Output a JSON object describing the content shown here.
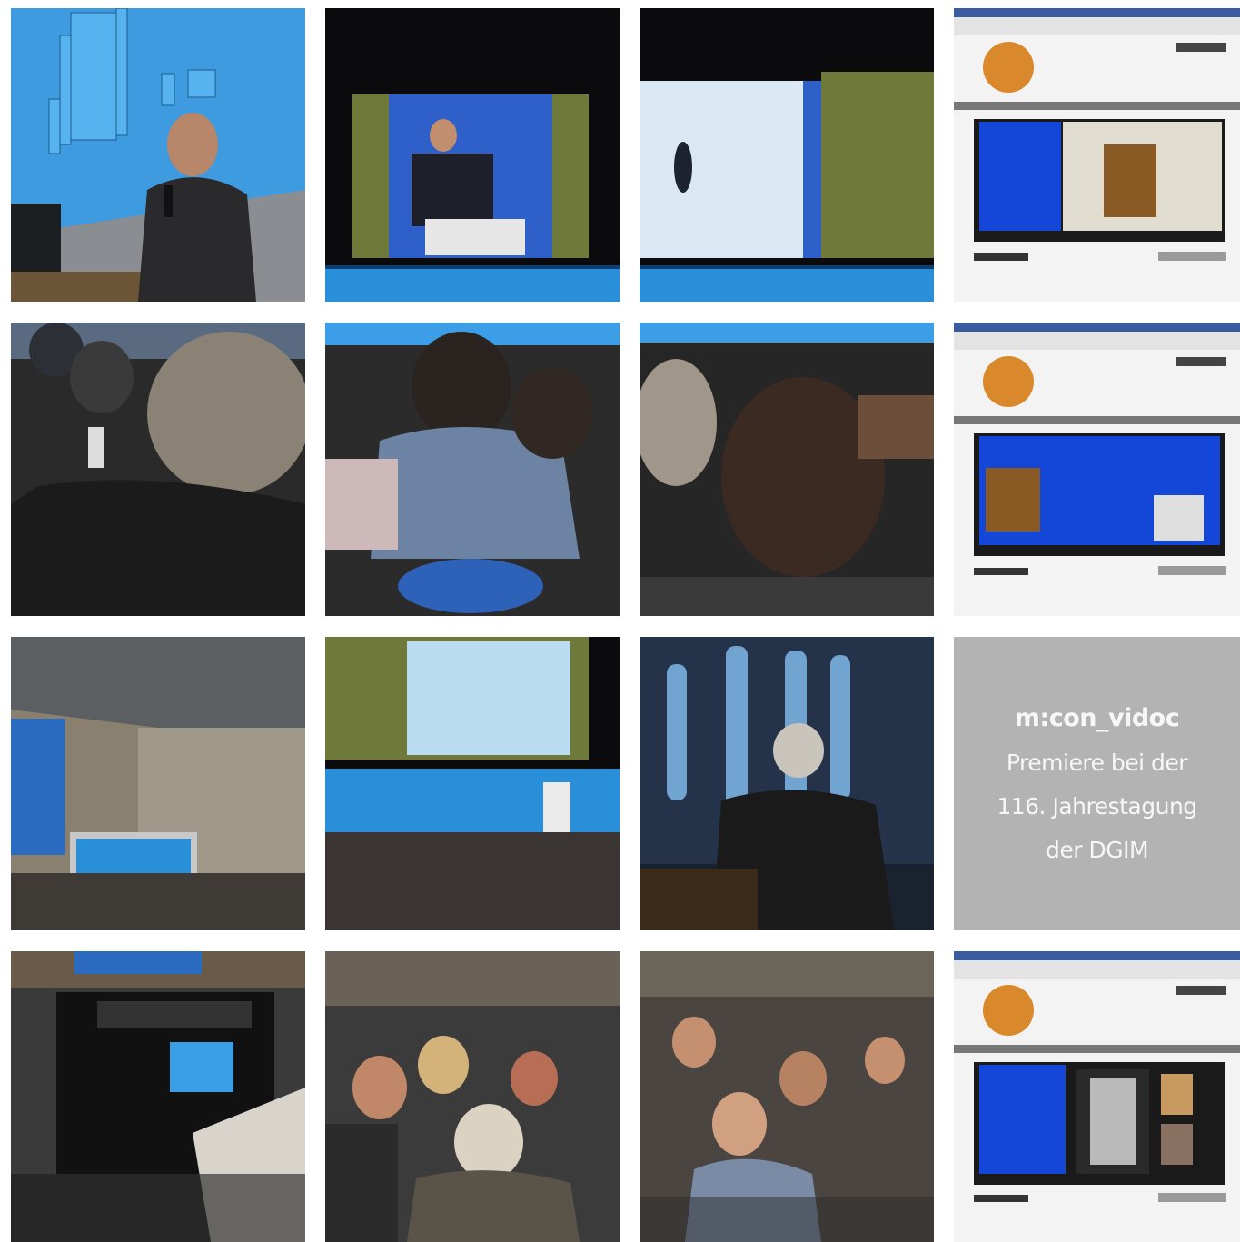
{
  "gallery": {
    "photos": [
      {
        "id": "speaker-slide",
        "subject": "Speaker at lectern in front of blue histogram slide"
      },
      {
        "id": "stage-screen-speaker",
        "subject": "Large screen showing speaker on stage"
      },
      {
        "id": "stage-screen-slide",
        "subject": "Large screen showing presentation slide"
      },
      {
        "id": "website-video-1",
        "subject": "Browser screenshot of video player page"
      },
      {
        "id": "audience-back-1",
        "subject": "Audience member from behind"
      },
      {
        "id": "audience-back-2",
        "subject": "Audience members seated facing screen"
      },
      {
        "id": "audience-back-3",
        "subject": "Audience member head from behind"
      },
      {
        "id": "website-video-2",
        "subject": "Browser screenshot of video player page"
      },
      {
        "id": "hall-monitor",
        "subject": "Conference hall with monitor in foreground"
      },
      {
        "id": "stage-wide",
        "subject": "Wide view of stage and audience"
      },
      {
        "id": "xray-speaker",
        "subject": "Speaker in front of X-ray hand projection"
      },
      {
        "id": "recording-device",
        "subject": "Recording equipment with keyboard"
      },
      {
        "id": "audience-front-1",
        "subject": "Seated audience listening"
      },
      {
        "id": "audience-front-2",
        "subject": "Seated audience listening"
      },
      {
        "id": "website-video-3",
        "subject": "Browser screenshot of video player page"
      }
    ],
    "text_tile": {
      "title": "m:con_vidoc",
      "line1": "Premiere bei der",
      "line2": "116. Jahrestagung",
      "line3": "der DGIM"
    }
  }
}
